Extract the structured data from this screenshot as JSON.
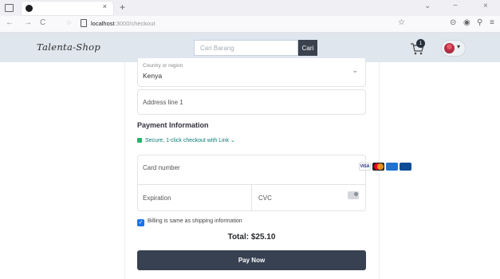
{
  "browser": {
    "tab_title": "",
    "tab_close": "×",
    "new_tab": "+",
    "url_host": "localhost",
    "url_path": ":3000/checkout",
    "nav_back": "←",
    "nav_forward": "→",
    "nav_reload": "C",
    "star": "☆",
    "win_min": "−",
    "win_close": "×",
    "win_caret": "⌄"
  },
  "site": {
    "brand": "Talenta-Shop",
    "search_placeholder": "Cari Barang",
    "search_button": "Cari",
    "cart_count": "1",
    "account_caret": "▾"
  },
  "checkout": {
    "country_label": "Country or region",
    "country_value": "Kenya",
    "address_placeholder": "Address line 1",
    "payment_title": "Payment Information",
    "link_text": "Secure, 1-click checkout with Link",
    "card_number_label": "Card number",
    "card_brands": [
      "visa",
      "mastercard",
      "amex",
      "jcb"
    ],
    "visa_text": "VISA",
    "expiration_label": "Expiration",
    "cvc_label": "CVC",
    "billing_text": "Billing is same as shipping information",
    "billing_checked": true,
    "total": "Total: $25.10",
    "pay_button": "Pay Now"
  },
  "colors": {
    "navbar_bg": "#dfe6ee",
    "search_button_bg": "#39424d",
    "pay_button_bg": "#374151",
    "link_color": "#0b7a75",
    "checkbox": "#1a73e8"
  }
}
